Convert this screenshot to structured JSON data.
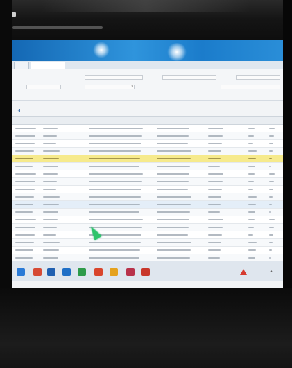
{
  "window": {
    "title": ""
  },
  "tabs": [
    {
      "label": "",
      "active": false
    },
    {
      "label": "",
      "active": true
    }
  ],
  "filters": [
    {
      "label": "",
      "value": ""
    },
    {
      "label": "",
      "value": ""
    },
    {
      "label": "",
      "value": ""
    },
    {
      "label": "",
      "value": ""
    },
    {
      "label": "",
      "value": ""
    },
    {
      "label": "",
      "value": ""
    }
  ],
  "toolbar": {
    "add_label": ""
  },
  "grid": {
    "columns": [
      "",
      "",
      "",
      "",
      "",
      "",
      ""
    ],
    "row_count": 19,
    "selected_row_index": 4,
    "hover_row_index": 10
  },
  "taskbar": {
    "alert_label": "",
    "icon_colors": [
      "#2a7ad6",
      "#d64a34",
      "#1f5fb0",
      "#1f6fc6",
      "#2e9b4a",
      "#d9452c",
      "#e5a21e",
      "#b8324a",
      "#c8372b"
    ]
  },
  "colors": {
    "title_band": "#2f94dc",
    "selected_row": "#f6ea8c",
    "cursor": "#2fc46b"
  }
}
